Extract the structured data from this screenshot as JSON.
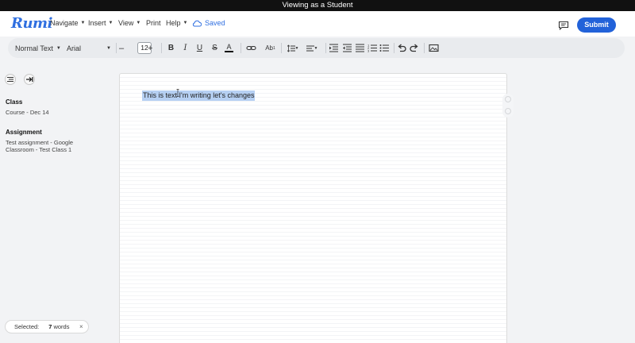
{
  "banner": {
    "text": "Viewing as a Student"
  },
  "app": {
    "logo": "Rumi"
  },
  "menu": {
    "navigate": "Navigate",
    "insert": "Insert",
    "view": "View",
    "print": "Print",
    "help": "Help"
  },
  "status": {
    "saved": "Saved"
  },
  "actions": {
    "submit": "Submit"
  },
  "toolbar": {
    "paragraph_style": "Normal Text",
    "font_family": "Arial",
    "font_size": "12",
    "minus": "–",
    "plus": "+"
  },
  "sidebar": {
    "class_heading": "Class",
    "class_value": "Course - Dec 14",
    "assignment_heading": "Assignment",
    "assignment_value": "Test assignment - Google Classroom - Test Class 1"
  },
  "document": {
    "text": "This is text I'm writing let's changes"
  },
  "selection": {
    "label": "Selected:",
    "count": "7",
    "unit": "words",
    "close": "×"
  },
  "colors": {
    "accent": "#2262d9",
    "selection": "#b6d0f3",
    "banner": "#111111"
  }
}
